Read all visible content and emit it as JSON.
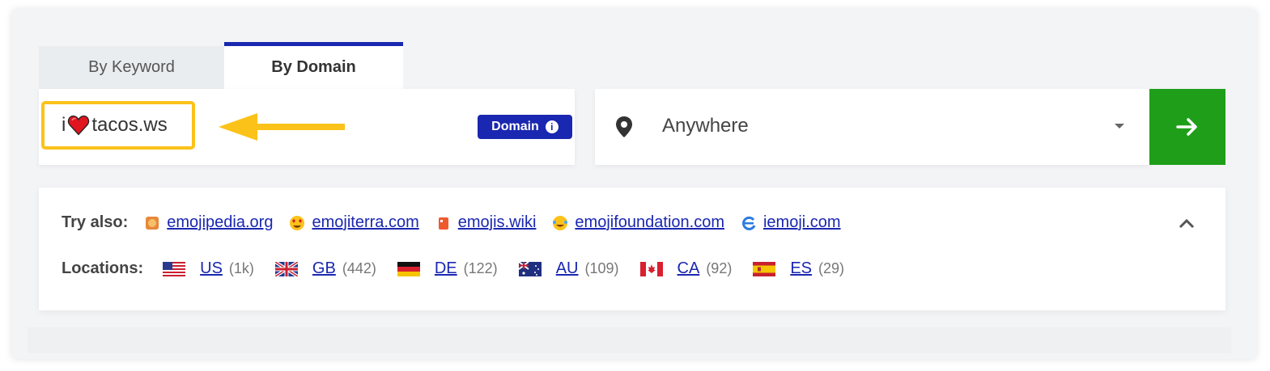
{
  "tabs": {
    "keyword": "By Keyword",
    "domain": "By Domain"
  },
  "search": {
    "query_prefix": "i",
    "query_suffix": "tacos.ws",
    "badge": "Domain",
    "info_icon": "i"
  },
  "location": {
    "value": "Anywhere"
  },
  "try_also": {
    "label": "Try also:",
    "sites": [
      {
        "name": "emojipedia.org",
        "icon": "emojipedia-icon"
      },
      {
        "name": "emojiterra.com",
        "icon": "heart-eyes-emoji-icon"
      },
      {
        "name": "emojis.wiki",
        "icon": "emojis-wiki-icon"
      },
      {
        "name": "emojifoundation.com",
        "icon": "tears-of-joy-emoji-icon"
      },
      {
        "name": "iemoji.com",
        "icon": "iemoji-icon"
      }
    ]
  },
  "locations": {
    "label": "Locations:",
    "items": [
      {
        "code": "US",
        "count": "(1k)"
      },
      {
        "code": "GB",
        "count": "(442)"
      },
      {
        "code": "DE",
        "count": "(122)"
      },
      {
        "code": "AU",
        "count": "(109)"
      },
      {
        "code": "CA",
        "count": "(92)"
      },
      {
        "code": "ES",
        "count": "(29)"
      }
    ]
  },
  "colors": {
    "brand_blue": "#1a27b0",
    "go_green": "#1f9e1a",
    "highlight_yellow": "#fbc21a"
  }
}
